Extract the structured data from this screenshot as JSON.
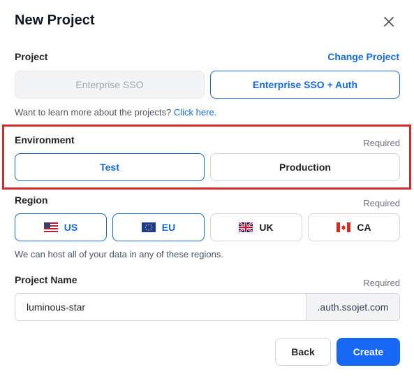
{
  "dialog": {
    "title": "New Project"
  },
  "project": {
    "label": "Project",
    "change_link": "Change Project",
    "options": [
      "Enterprise SSO",
      "Enterprise SSO + Auth"
    ],
    "help_text": "Want to learn more about the projects?",
    "help_link": "Click here."
  },
  "environment": {
    "label": "Environment",
    "required": "Required",
    "options": [
      "Test",
      "Production"
    ],
    "selected": "Test"
  },
  "region": {
    "label": "Region",
    "required": "Required",
    "options": [
      "US",
      "EU",
      "UK",
      "CA"
    ],
    "selected": [
      "US",
      "EU"
    ],
    "help_text": "We can host all of your data in any of these regions."
  },
  "project_name": {
    "label": "Project Name",
    "required": "Required",
    "value": "luminous-star",
    "suffix": ".auth.ssojet.com"
  },
  "footer": {
    "back": "Back",
    "create": "Create"
  },
  "colors": {
    "accent": "#1769e0",
    "primary_button": "#1769f5",
    "highlight_border": "#d42b2b"
  }
}
